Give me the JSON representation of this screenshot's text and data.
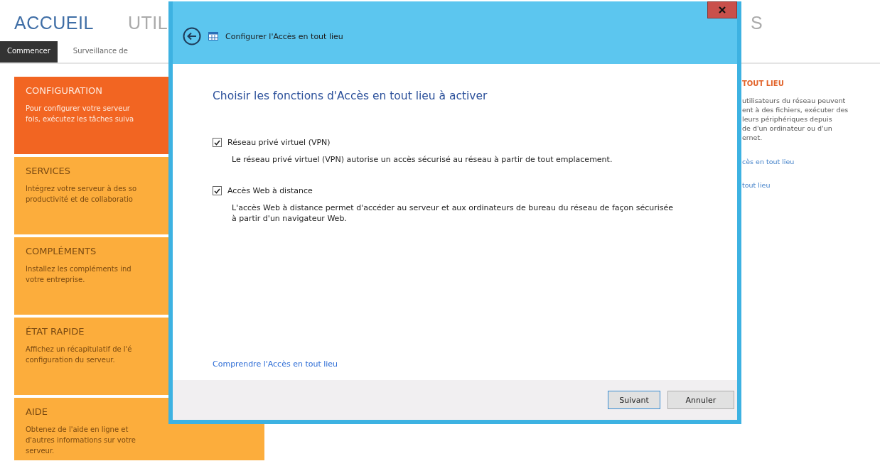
{
  "header_tabs": [
    {
      "label": "ACCUEIL",
      "selected": true
    },
    {
      "label": "UTIL",
      "selected": false
    },
    {
      "label": "S",
      "selected": false
    }
  ],
  "sub_tabs": [
    {
      "label": "Commencer",
      "selected": true
    },
    {
      "label": "Surveillance de",
      "selected": false
    }
  ],
  "tiles": [
    {
      "title": "CONFIGURATION",
      "lines": [
        "Pour configurer votre serveur",
        "fois, exécutez les tâches suiva"
      ],
      "selected": true
    },
    {
      "title": "SERVICES",
      "lines": [
        "Intégrez votre serveur à des so",
        "productivité et de collaboratio"
      ],
      "selected": false
    },
    {
      "title": "COMPLÉMENTS",
      "lines": [
        "Installez les compléments ind",
        "votre entreprise."
      ],
      "selected": false
    },
    {
      "title": "ÉTAT RAPIDE",
      "lines": [
        "Affichez un récapitulatif de l'é",
        "configuration du serveur."
      ],
      "selected": false
    },
    {
      "title": "AIDE",
      "lines": [
        "Obtenez de l'aide en ligne et d'autres informations sur votre serveur."
      ],
      "selected": false
    }
  ],
  "right_panel": {
    "title": "TOUT LIEU",
    "lines": [
      "utilisateurs du réseau peuvent",
      "ent à des fichiers, exécuter des",
      "leurs périphériques depuis",
      "de d'un ordinateur ou d'un",
      "ernet."
    ],
    "links": [
      "cès en tout lieu",
      "tout lieu"
    ]
  },
  "dialog": {
    "title": "Configurer l'Accès en tout lieu",
    "heading": "Choisir les fonctions d'Accès en tout lieu à activer",
    "options": [
      {
        "label": "Réseau privé virtuel (VPN)",
        "description": "Le réseau privé virtuel (VPN) autorise un accès sécurisé au réseau à partir de tout emplacement.",
        "checked": true
      },
      {
        "label": "Accès Web à distance",
        "description": "L'accès Web à distance permet d'accéder au serveur et aux ordinateurs de bureau du réseau de façon sécurisée à partir d'un navigateur Web.",
        "checked": true
      }
    ],
    "link": "Comprendre l'Accès en tout lieu",
    "buttons": [
      "Suivant",
      "Annuler"
    ]
  }
}
